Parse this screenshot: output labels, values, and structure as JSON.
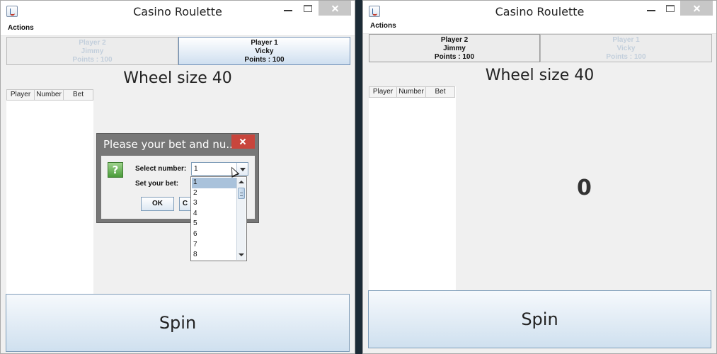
{
  "windows": {
    "left": {
      "title": "Casino Roulette",
      "menu": "Actions",
      "tabs": [
        {
          "name": "Player 2",
          "user": "Jimmy",
          "points": "Points : 100"
        },
        {
          "name": "Player 1",
          "user": "Vicky",
          "points": "Points : 100"
        }
      ],
      "wheel_title": "Wheel size 40",
      "table_headers": [
        "Player",
        "Number",
        "Bet"
      ],
      "spin_label": "Spin"
    },
    "right": {
      "title": "Casino Roulette",
      "menu": "Actions",
      "tabs": [
        {
          "name": "Player 2",
          "user": "Jimmy",
          "points": "Points : 100"
        },
        {
          "name": "Player 1",
          "user": "Vicky",
          "points": "Points : 100"
        }
      ],
      "wheel_title": "Wheel size 40",
      "table_headers": [
        "Player",
        "Number",
        "Bet"
      ],
      "result": "0",
      "spin_label": "Spin"
    }
  },
  "dialog": {
    "title": "Please your bet and nu...",
    "select_label": "Select number:",
    "bet_label": "Set your bet:",
    "selected_value": "1",
    "options": [
      "1",
      "2",
      "3",
      "4",
      "5",
      "6",
      "7",
      "8"
    ],
    "ok_label": "OK",
    "cancel_label": "C"
  },
  "icons": {
    "app": "java-cup-icon",
    "question": "question-icon"
  },
  "colors": {
    "close_button": "#c7c7c7",
    "dialog_close": "#c8453c",
    "tab_active": "#cfdff0",
    "dialog_frame": "#777777"
  }
}
